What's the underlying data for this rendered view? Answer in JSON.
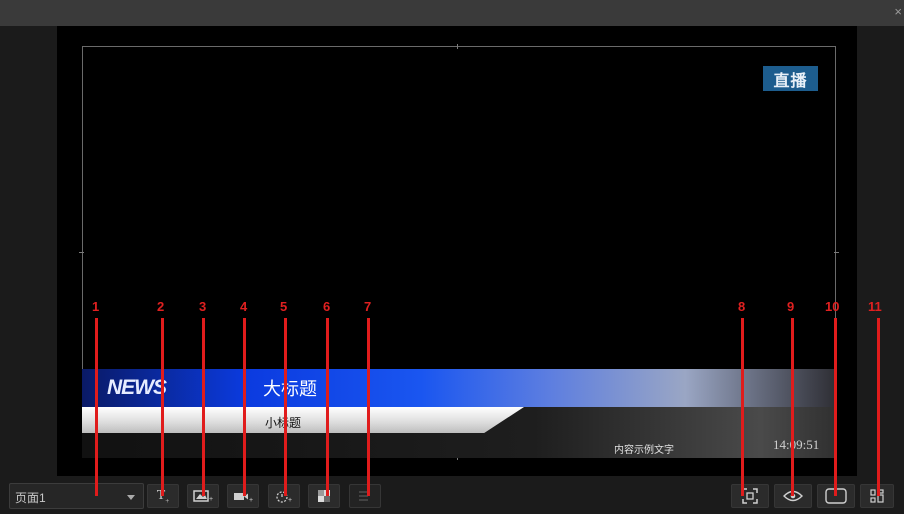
{
  "window": {
    "close_glyph": "×"
  },
  "preview": {
    "live_badge": "直播",
    "news_logo": "NEWS",
    "main_title": "大标题",
    "sub_title": "小标题",
    "content_text": "内容示例文字",
    "clock": "14:09:51"
  },
  "toolbar": {
    "page_select_value": "页面1",
    "left_buttons": [
      {
        "icon": "text-add-icon",
        "glyph": "T"
      },
      {
        "icon": "image-add-icon"
      },
      {
        "icon": "video-add-icon"
      },
      {
        "icon": "timer-add-icon"
      },
      {
        "icon": "mosaic-icon"
      },
      {
        "icon": "list-add-icon",
        "disabled": true
      }
    ],
    "right_buttons": [
      {
        "icon": "fit-frame-icon"
      },
      {
        "icon": "eye-icon"
      },
      {
        "icon": "rectangle-icon"
      },
      {
        "icon": "layout-icon"
      }
    ]
  },
  "annotations": [
    "1",
    "2",
    "3",
    "4",
    "5",
    "6",
    "7",
    "8",
    "9",
    "10",
    "11"
  ],
  "colors": {
    "annotation": "#e01c1c",
    "live_badge": "#1d5d8e",
    "news_bar_blue": "#0b3be0"
  }
}
